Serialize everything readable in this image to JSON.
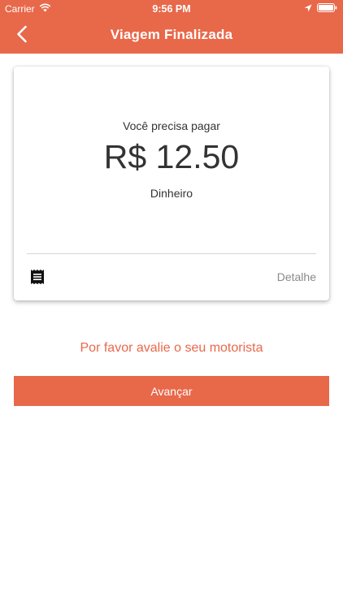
{
  "status_bar": {
    "carrier": "Carrier",
    "time": "9:56 PM"
  },
  "header": {
    "title": "Viagem Finalizada",
    "back_icon": "chevron-left-icon"
  },
  "card": {
    "label": "Você precisa pagar",
    "amount": "R$ 12.50",
    "payment_method": "Dinheiro",
    "receipt_icon": "receipt-icon",
    "detail_link": "Detalhe"
  },
  "rate_prompt": "Por favor avalie o seu motorista",
  "advance_button": "Avançar",
  "colors": {
    "accent": "#E8684A",
    "text": "#333333",
    "muted": "#8a8a8a"
  }
}
